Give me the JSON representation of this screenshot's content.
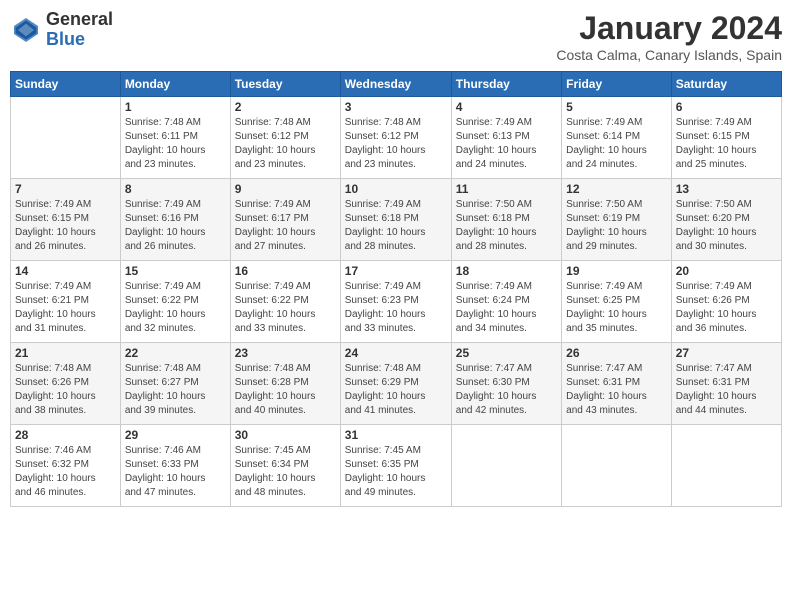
{
  "header": {
    "logo_line1": "General",
    "logo_line2": "Blue",
    "month_title": "January 2024",
    "subtitle": "Costa Calma, Canary Islands, Spain"
  },
  "days_of_week": [
    "Sunday",
    "Monday",
    "Tuesday",
    "Wednesday",
    "Thursday",
    "Friday",
    "Saturday"
  ],
  "weeks": [
    [
      {
        "day": "",
        "content": ""
      },
      {
        "day": "1",
        "content": "Sunrise: 7:48 AM\nSunset: 6:11 PM\nDaylight: 10 hours\nand 23 minutes."
      },
      {
        "day": "2",
        "content": "Sunrise: 7:48 AM\nSunset: 6:12 PM\nDaylight: 10 hours\nand 23 minutes."
      },
      {
        "day": "3",
        "content": "Sunrise: 7:48 AM\nSunset: 6:12 PM\nDaylight: 10 hours\nand 23 minutes."
      },
      {
        "day": "4",
        "content": "Sunrise: 7:49 AM\nSunset: 6:13 PM\nDaylight: 10 hours\nand 24 minutes."
      },
      {
        "day": "5",
        "content": "Sunrise: 7:49 AM\nSunset: 6:14 PM\nDaylight: 10 hours\nand 24 minutes."
      },
      {
        "day": "6",
        "content": "Sunrise: 7:49 AM\nSunset: 6:15 PM\nDaylight: 10 hours\nand 25 minutes."
      }
    ],
    [
      {
        "day": "7",
        "content": "Sunrise: 7:49 AM\nSunset: 6:15 PM\nDaylight: 10 hours\nand 26 minutes."
      },
      {
        "day": "8",
        "content": "Sunrise: 7:49 AM\nSunset: 6:16 PM\nDaylight: 10 hours\nand 26 minutes."
      },
      {
        "day": "9",
        "content": "Sunrise: 7:49 AM\nSunset: 6:17 PM\nDaylight: 10 hours\nand 27 minutes."
      },
      {
        "day": "10",
        "content": "Sunrise: 7:49 AM\nSunset: 6:18 PM\nDaylight: 10 hours\nand 28 minutes."
      },
      {
        "day": "11",
        "content": "Sunrise: 7:50 AM\nSunset: 6:18 PM\nDaylight: 10 hours\nand 28 minutes."
      },
      {
        "day": "12",
        "content": "Sunrise: 7:50 AM\nSunset: 6:19 PM\nDaylight: 10 hours\nand 29 minutes."
      },
      {
        "day": "13",
        "content": "Sunrise: 7:50 AM\nSunset: 6:20 PM\nDaylight: 10 hours\nand 30 minutes."
      }
    ],
    [
      {
        "day": "14",
        "content": "Sunrise: 7:49 AM\nSunset: 6:21 PM\nDaylight: 10 hours\nand 31 minutes."
      },
      {
        "day": "15",
        "content": "Sunrise: 7:49 AM\nSunset: 6:22 PM\nDaylight: 10 hours\nand 32 minutes."
      },
      {
        "day": "16",
        "content": "Sunrise: 7:49 AM\nSunset: 6:22 PM\nDaylight: 10 hours\nand 33 minutes."
      },
      {
        "day": "17",
        "content": "Sunrise: 7:49 AM\nSunset: 6:23 PM\nDaylight: 10 hours\nand 33 minutes."
      },
      {
        "day": "18",
        "content": "Sunrise: 7:49 AM\nSunset: 6:24 PM\nDaylight: 10 hours\nand 34 minutes."
      },
      {
        "day": "19",
        "content": "Sunrise: 7:49 AM\nSunset: 6:25 PM\nDaylight: 10 hours\nand 35 minutes."
      },
      {
        "day": "20",
        "content": "Sunrise: 7:49 AM\nSunset: 6:26 PM\nDaylight: 10 hours\nand 36 minutes."
      }
    ],
    [
      {
        "day": "21",
        "content": "Sunrise: 7:48 AM\nSunset: 6:26 PM\nDaylight: 10 hours\nand 38 minutes."
      },
      {
        "day": "22",
        "content": "Sunrise: 7:48 AM\nSunset: 6:27 PM\nDaylight: 10 hours\nand 39 minutes."
      },
      {
        "day": "23",
        "content": "Sunrise: 7:48 AM\nSunset: 6:28 PM\nDaylight: 10 hours\nand 40 minutes."
      },
      {
        "day": "24",
        "content": "Sunrise: 7:48 AM\nSunset: 6:29 PM\nDaylight: 10 hours\nand 41 minutes."
      },
      {
        "day": "25",
        "content": "Sunrise: 7:47 AM\nSunset: 6:30 PM\nDaylight: 10 hours\nand 42 minutes."
      },
      {
        "day": "26",
        "content": "Sunrise: 7:47 AM\nSunset: 6:31 PM\nDaylight: 10 hours\nand 43 minutes."
      },
      {
        "day": "27",
        "content": "Sunrise: 7:47 AM\nSunset: 6:31 PM\nDaylight: 10 hours\nand 44 minutes."
      }
    ],
    [
      {
        "day": "28",
        "content": "Sunrise: 7:46 AM\nSunset: 6:32 PM\nDaylight: 10 hours\nand 46 minutes."
      },
      {
        "day": "29",
        "content": "Sunrise: 7:46 AM\nSunset: 6:33 PM\nDaylight: 10 hours\nand 47 minutes."
      },
      {
        "day": "30",
        "content": "Sunrise: 7:45 AM\nSunset: 6:34 PM\nDaylight: 10 hours\nand 48 minutes."
      },
      {
        "day": "31",
        "content": "Sunrise: 7:45 AM\nSunset: 6:35 PM\nDaylight: 10 hours\nand 49 minutes."
      },
      {
        "day": "",
        "content": ""
      },
      {
        "day": "",
        "content": ""
      },
      {
        "day": "",
        "content": ""
      }
    ]
  ]
}
